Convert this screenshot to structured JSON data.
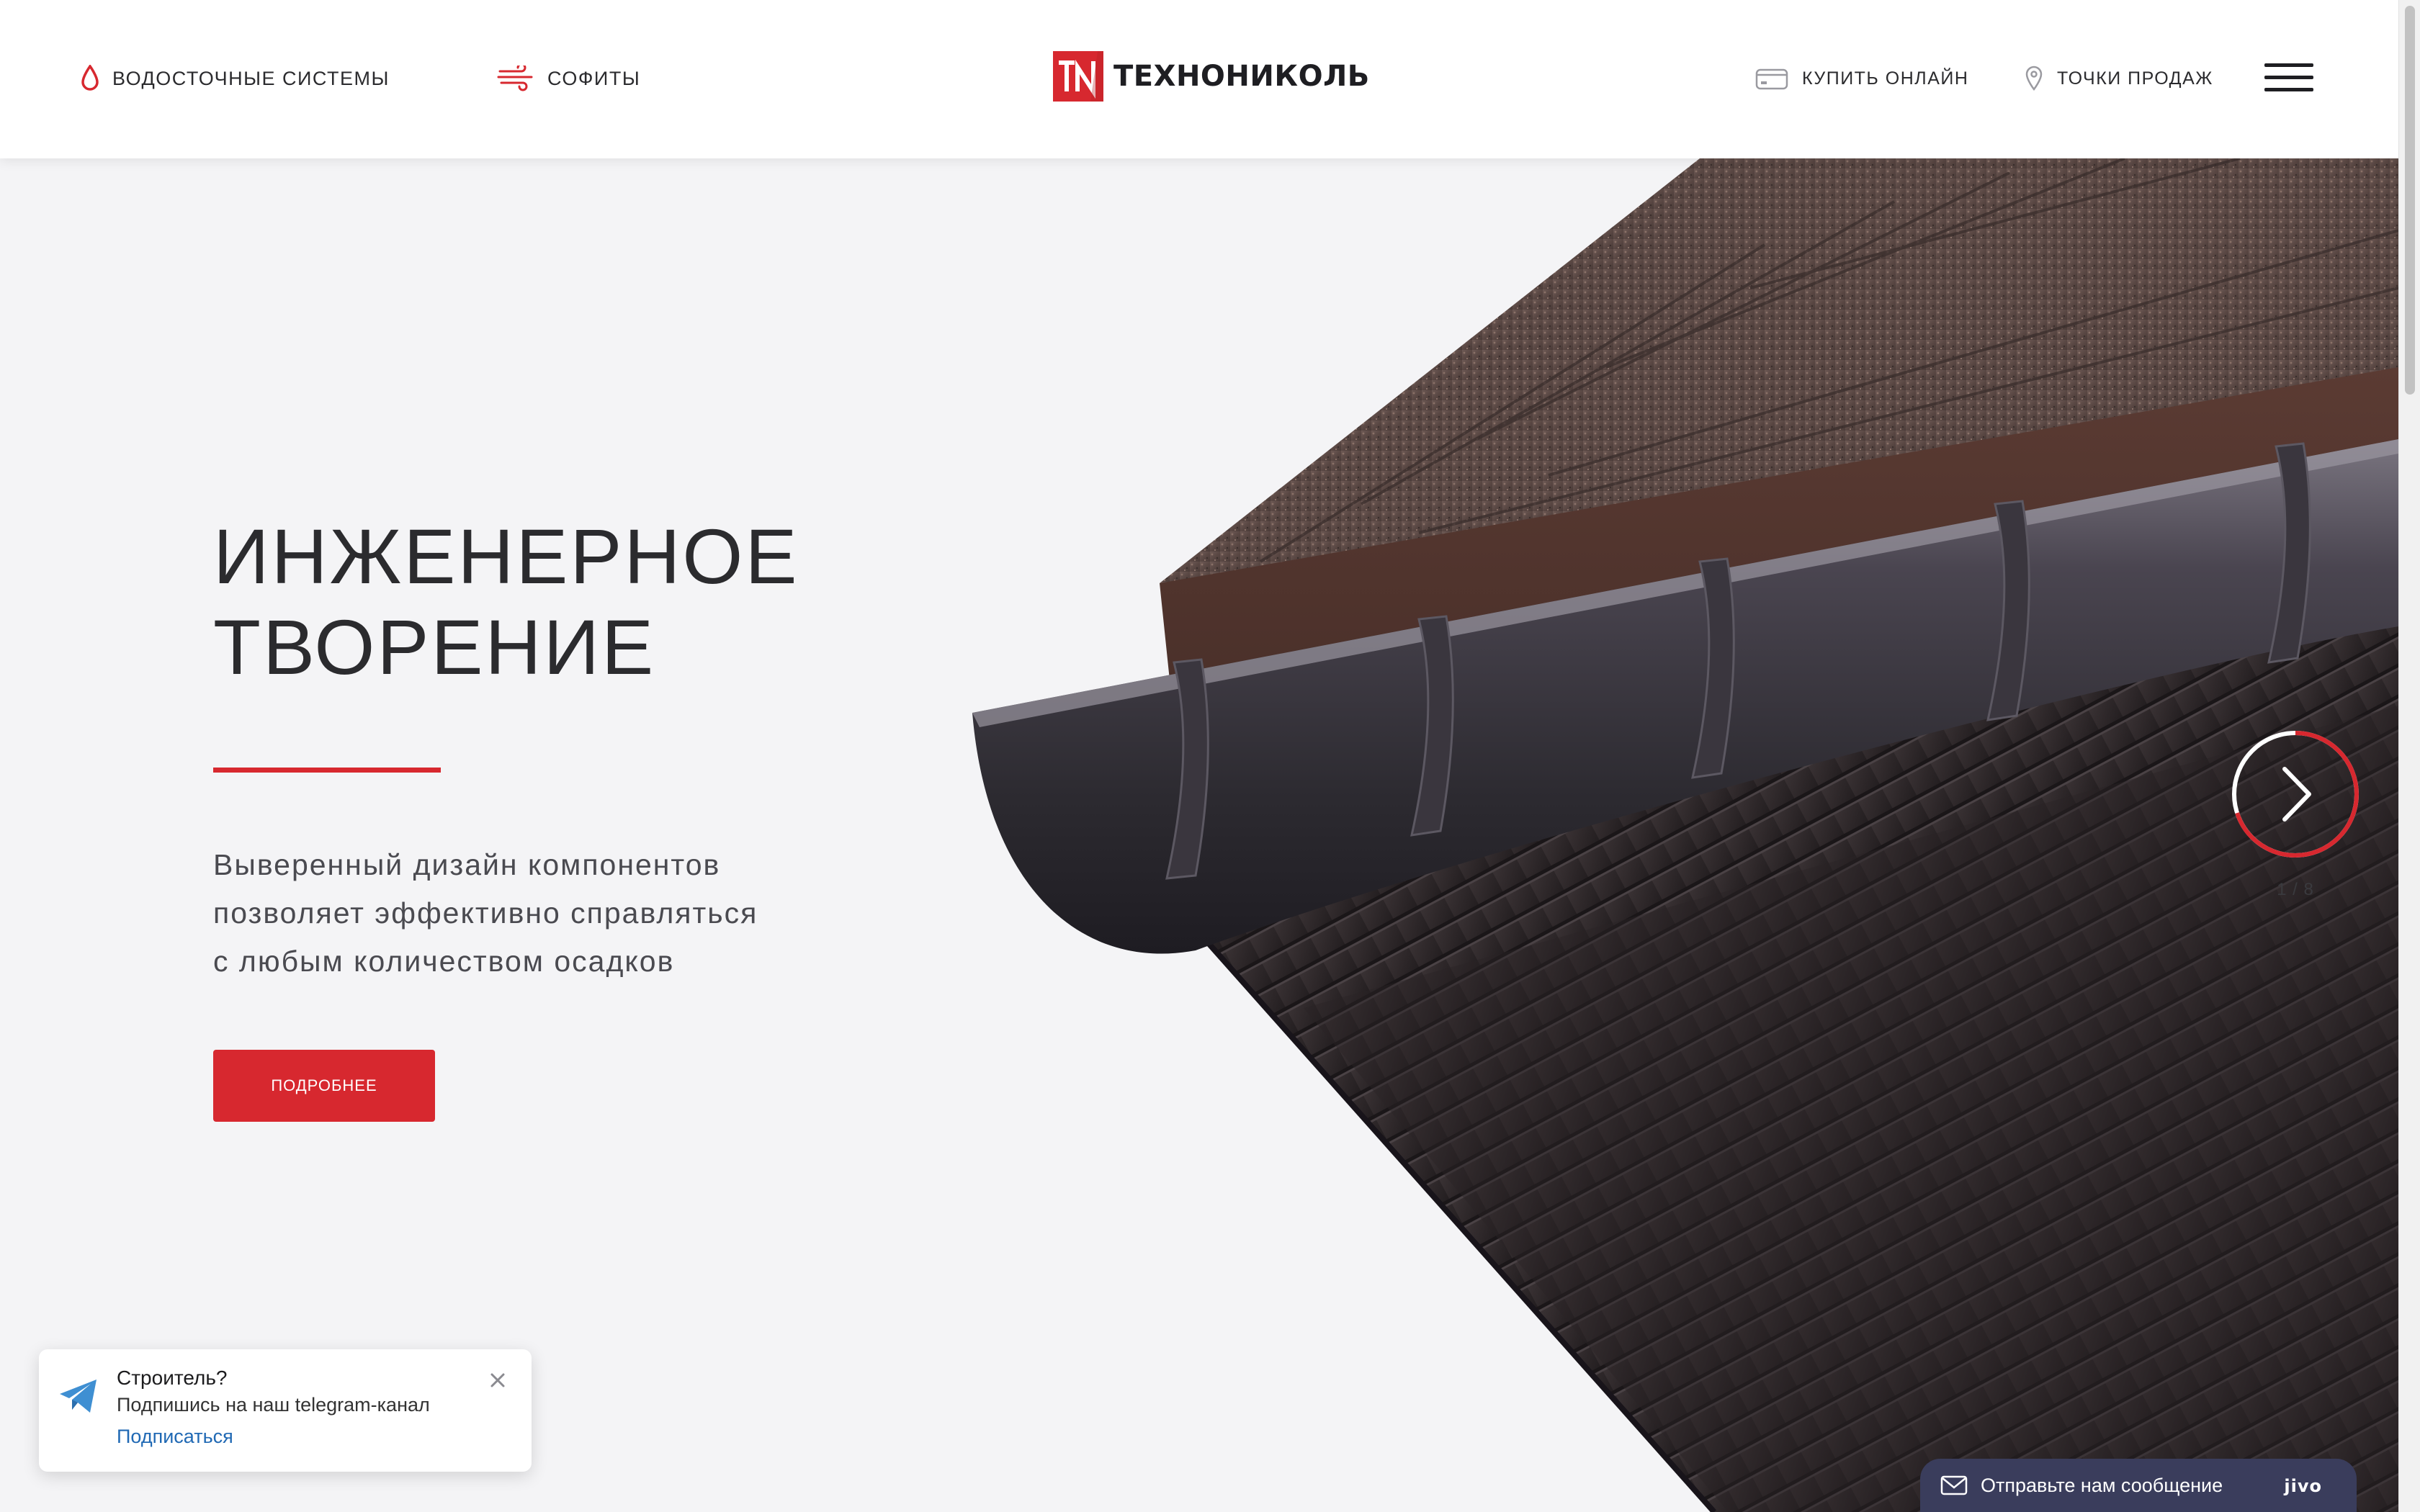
{
  "header": {
    "nav_left": [
      {
        "label": "Водосточные системы",
        "icon": "drop-icon"
      },
      {
        "label": "Софиты",
        "icon": "wind-icon"
      }
    ],
    "logo_text": "ТЕХНОНИКОЛЬ",
    "logo_mark": "TN",
    "nav_right": [
      {
        "label": "Купить онлайн",
        "icon": "card-icon"
      },
      {
        "label": "Точки продаж",
        "icon": "map-pin-icon"
      }
    ],
    "menu_icon": "hamburger-menu-icon"
  },
  "hero": {
    "title_line1": "Инженерное",
    "title_line2": "творение",
    "description_line1": "Выверенный дизайн компонентов",
    "description_line2": "позволяет эффективно справляться",
    "description_line3": "с любым количеством осадков",
    "button_label": "Подробнее",
    "image": "roof-gutter-soffit-illustration"
  },
  "slider": {
    "counter": "1 / 8",
    "next_icon": "chevron-right-icon",
    "progress": 0.7
  },
  "telegram_popup": {
    "title": "Строитель?",
    "text": "Подпишись на наш telegram-канал",
    "link": "Подписаться",
    "icon": "telegram-plane-icon",
    "close_icon": "close-icon"
  },
  "chat_widget": {
    "label": "Отправьте нам сообщение",
    "brand": "jivo",
    "icon": "mail-icon"
  },
  "colors": {
    "accent": "#d7282f",
    "text_dark": "#2b2b2e",
    "background": "#f4f4f6",
    "link": "#2069b4",
    "chat_bg": "#3a3d5c"
  }
}
